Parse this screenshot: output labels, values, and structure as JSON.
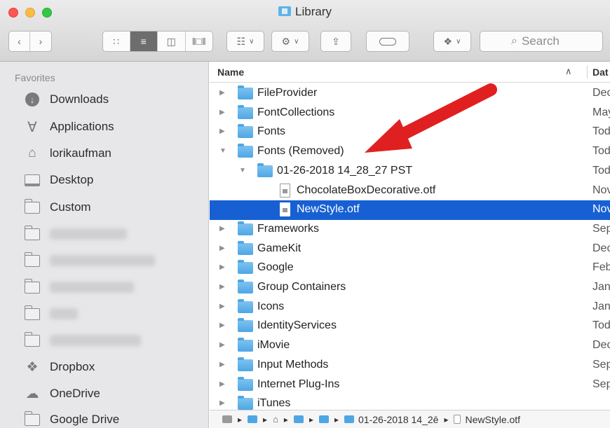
{
  "window": {
    "title": "Library"
  },
  "toolbar": {
    "search_placeholder": "Search"
  },
  "sidebar": {
    "header": "Favorites",
    "items": [
      {
        "label": "Downloads",
        "icon": "download-icon"
      },
      {
        "label": "Applications",
        "icon": "applications-icon"
      },
      {
        "label": "lorikaufman",
        "icon": "home-icon"
      },
      {
        "label": "Desktop",
        "icon": "desktop-icon"
      },
      {
        "label": "Custom",
        "icon": "folder-icon"
      },
      {
        "label": "",
        "icon": "folder-icon"
      },
      {
        "label": "",
        "icon": "folder-icon"
      },
      {
        "label": "",
        "icon": "folder-icon"
      },
      {
        "label": "",
        "icon": "folder-icon"
      },
      {
        "label": "",
        "icon": "folder-icon"
      },
      {
        "label": "Dropbox",
        "icon": "dropbox-icon"
      },
      {
        "label": "OneDrive",
        "icon": "cloud-icon"
      },
      {
        "label": "Google Drive",
        "icon": "folder-icon"
      }
    ]
  },
  "list": {
    "headers": {
      "name": "Name",
      "date": "Dat"
    },
    "rows": [
      {
        "name": "FileProvider",
        "date": "Dec",
        "type": "folder",
        "level": 0,
        "open": false
      },
      {
        "name": "FontCollections",
        "date": "May",
        "type": "folder",
        "level": 0,
        "open": false
      },
      {
        "name": "Fonts",
        "date": "Tod",
        "type": "folder",
        "level": 0,
        "open": false
      },
      {
        "name": "Fonts (Removed)",
        "date": "Tod",
        "type": "folder",
        "level": 0,
        "open": true
      },
      {
        "name": "01-26-2018 14_28_27 PST",
        "date": "Tod",
        "type": "folder",
        "level": 1,
        "open": true
      },
      {
        "name": "ChocolateBoxDecorative.otf",
        "date": "Nov",
        "type": "file",
        "level": 2
      },
      {
        "name": "NewStyle.otf",
        "date": "Nov",
        "type": "file",
        "level": 2,
        "selected": true
      },
      {
        "name": "Frameworks",
        "date": "Sep",
        "type": "folder",
        "level": 0,
        "open": false
      },
      {
        "name": "GameKit",
        "date": "Dec",
        "type": "folder",
        "level": 0,
        "open": false
      },
      {
        "name": "Google",
        "date": "Feb",
        "type": "folder",
        "level": 0,
        "open": false
      },
      {
        "name": "Group Containers",
        "date": "Jan",
        "type": "folder",
        "level": 0,
        "open": false
      },
      {
        "name": "Icons",
        "date": "Jan",
        "type": "folder",
        "level": 0,
        "open": false
      },
      {
        "name": "IdentityServices",
        "date": "Tod",
        "type": "folder",
        "level": 0,
        "open": false
      },
      {
        "name": "iMovie",
        "date": "Dec",
        "type": "folder",
        "level": 0,
        "open": false
      },
      {
        "name": "Input Methods",
        "date": "Sep",
        "type": "folder",
        "level": 0,
        "open": false
      },
      {
        "name": "Internet Plug-Ins",
        "date": "Sep",
        "type": "folder",
        "level": 0,
        "open": false
      },
      {
        "name": "iTunes",
        "date": "",
        "type": "folder",
        "level": 0,
        "open": false
      }
    ]
  },
  "pathbar": {
    "segments": [
      {
        "icon": "disk-icon",
        "label": ""
      },
      {
        "icon": "folder-icon",
        "label": ""
      },
      {
        "icon": "home-icon",
        "label": ""
      },
      {
        "icon": "library-icon",
        "label": ""
      },
      {
        "icon": "folder-icon",
        "label": ""
      },
      {
        "icon": "folder-icon",
        "label": "01-26-2018 14_2ē"
      },
      {
        "icon": "document-icon",
        "label": "NewStyle.otf"
      }
    ]
  },
  "colors": {
    "selection": "#1760d4",
    "folder": "#5fb3e8",
    "arrow": "#e02020"
  }
}
